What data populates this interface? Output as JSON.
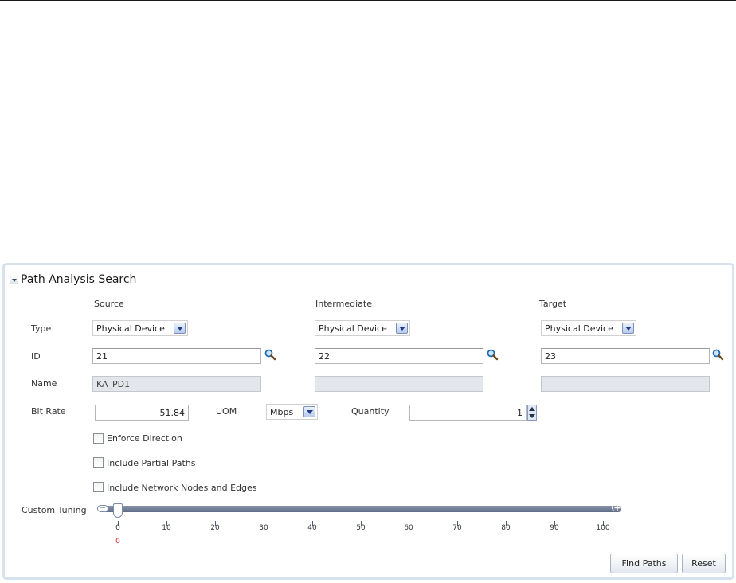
{
  "panel": {
    "title": "Path Analysis Search"
  },
  "columns": {
    "source": "Source",
    "intermediate": "Intermediate",
    "target": "Target"
  },
  "labels": {
    "type": "Type",
    "id": "ID",
    "name": "Name",
    "bit_rate": "Bit Rate",
    "uom": "UOM",
    "quantity": "Quantity",
    "custom_tuning": "Custom Tuning"
  },
  "source": {
    "type": "Physical Device",
    "id": "21",
    "name": "KA_PD1"
  },
  "intermediate": {
    "type": "Physical Device",
    "id": "22",
    "name": ""
  },
  "target": {
    "type": "Physical Device",
    "id": "23",
    "name": ""
  },
  "bit_rate": "51.84",
  "uom": "Mbps",
  "quantity": "1",
  "checkboxes": {
    "enforce_direction": "Enforce Direction",
    "include_partial_paths": "Include Partial Paths",
    "include_network_nodes": "Include Network Nodes and Edges"
  },
  "slider": {
    "min": 0,
    "max": 100,
    "value": 0,
    "ticks": [
      "0",
      "10",
      "20",
      "30",
      "40",
      "50",
      "60",
      "70",
      "80",
      "90",
      "100"
    ],
    "current_label": "0",
    "minus_icon": "minus-icon",
    "plus_icon": "plus-icon"
  },
  "buttons": {
    "find_paths": "Find Paths",
    "reset": "Reset"
  },
  "colors": {
    "panel_border": "#d8e2ee",
    "slider_value": "#e0201b",
    "search_icon": "#1f6fb8"
  }
}
